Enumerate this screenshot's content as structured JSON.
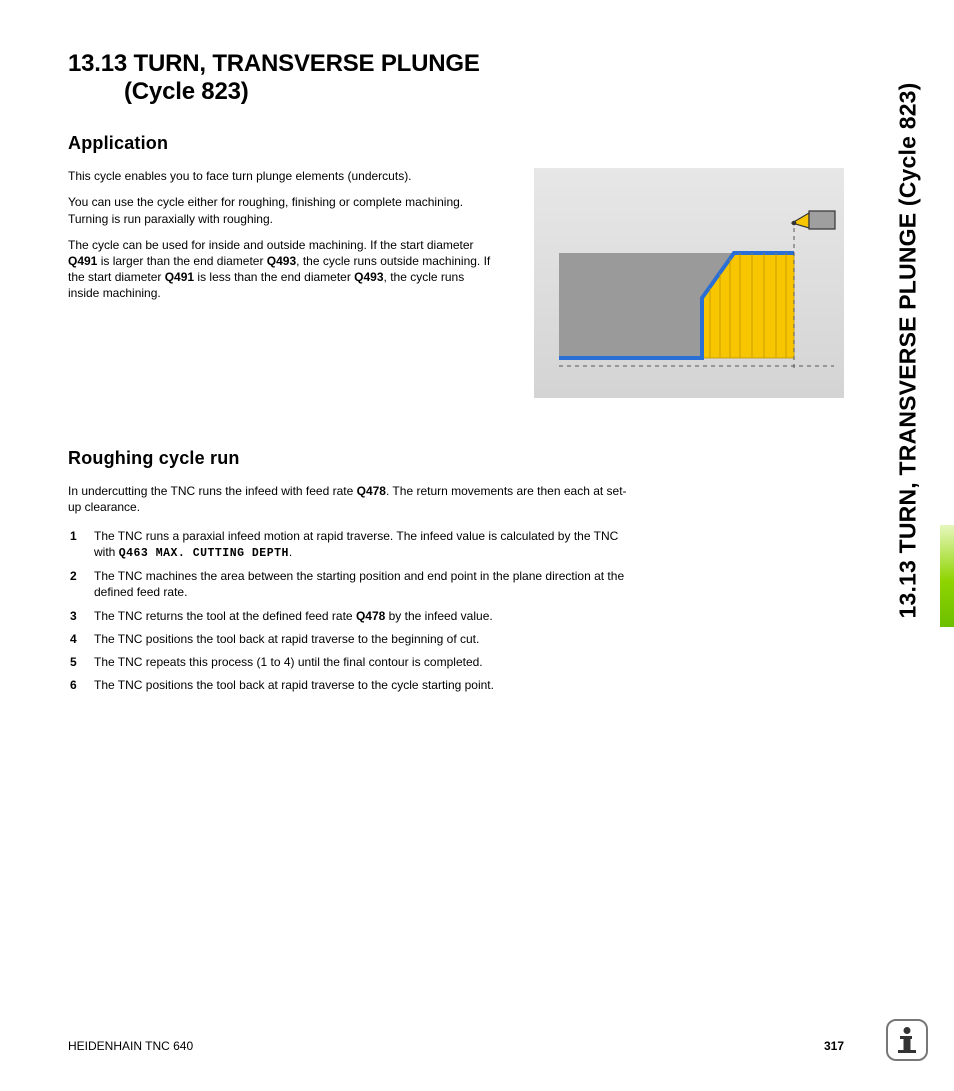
{
  "sideTitle": "13.13 TURN, TRANSVERSE PLUNGE (Cycle 823)",
  "title": {
    "line1": "13.13 TURN, TRANSVERSE PLUNGE",
    "line2": "(Cycle 823)"
  },
  "application": {
    "heading": "Application",
    "p1": "This cycle enables you to face turn plunge elements (undercuts).",
    "p2": "You can use the cycle either for roughing, finishing or complete machining. Turning is run paraxially with roughing.",
    "p3a": "The cycle can be used for inside and outside machining. If the start diameter ",
    "p3b": "Q491",
    "p3c": " is larger than the end diameter ",
    "p3d": "Q493",
    "p3e": ", the cycle runs outside machining. If the start diameter ",
    "p3f": "Q491",
    "p3g": " is less than the end diameter ",
    "p3h": "Q493",
    "p3i": ", the cycle runs inside machining."
  },
  "roughing": {
    "heading": "Roughing cycle run",
    "intro_a": "In undercutting the TNC runs the infeed with feed rate ",
    "intro_b": "Q478",
    "intro_c": ". The return movements are then each at set-up clearance.",
    "steps": {
      "s1a": "The TNC runs a paraxial infeed motion at rapid traverse. The infeed value is calculated by the TNC with ",
      "s1b": "Q463 MAX. CUTTING DEPTH",
      "s1c": ".",
      "s2": "The TNC machines the area between the starting position and end point in the plane direction at the defined feed rate.",
      "s3a": "The TNC returns the tool at the defined feed rate ",
      "s3b": "Q478",
      "s3c": " by the infeed value.",
      "s4": "The TNC positions the tool back at rapid traverse to the beginning of cut.",
      "s5": "The TNC repeats this process (1 to 4) until the final contour is completed.",
      "s6": "The TNC positions the tool back at rapid traverse to the cycle starting point."
    }
  },
  "footer": {
    "left": "HEIDENHAIN TNC 640",
    "page": "317"
  }
}
